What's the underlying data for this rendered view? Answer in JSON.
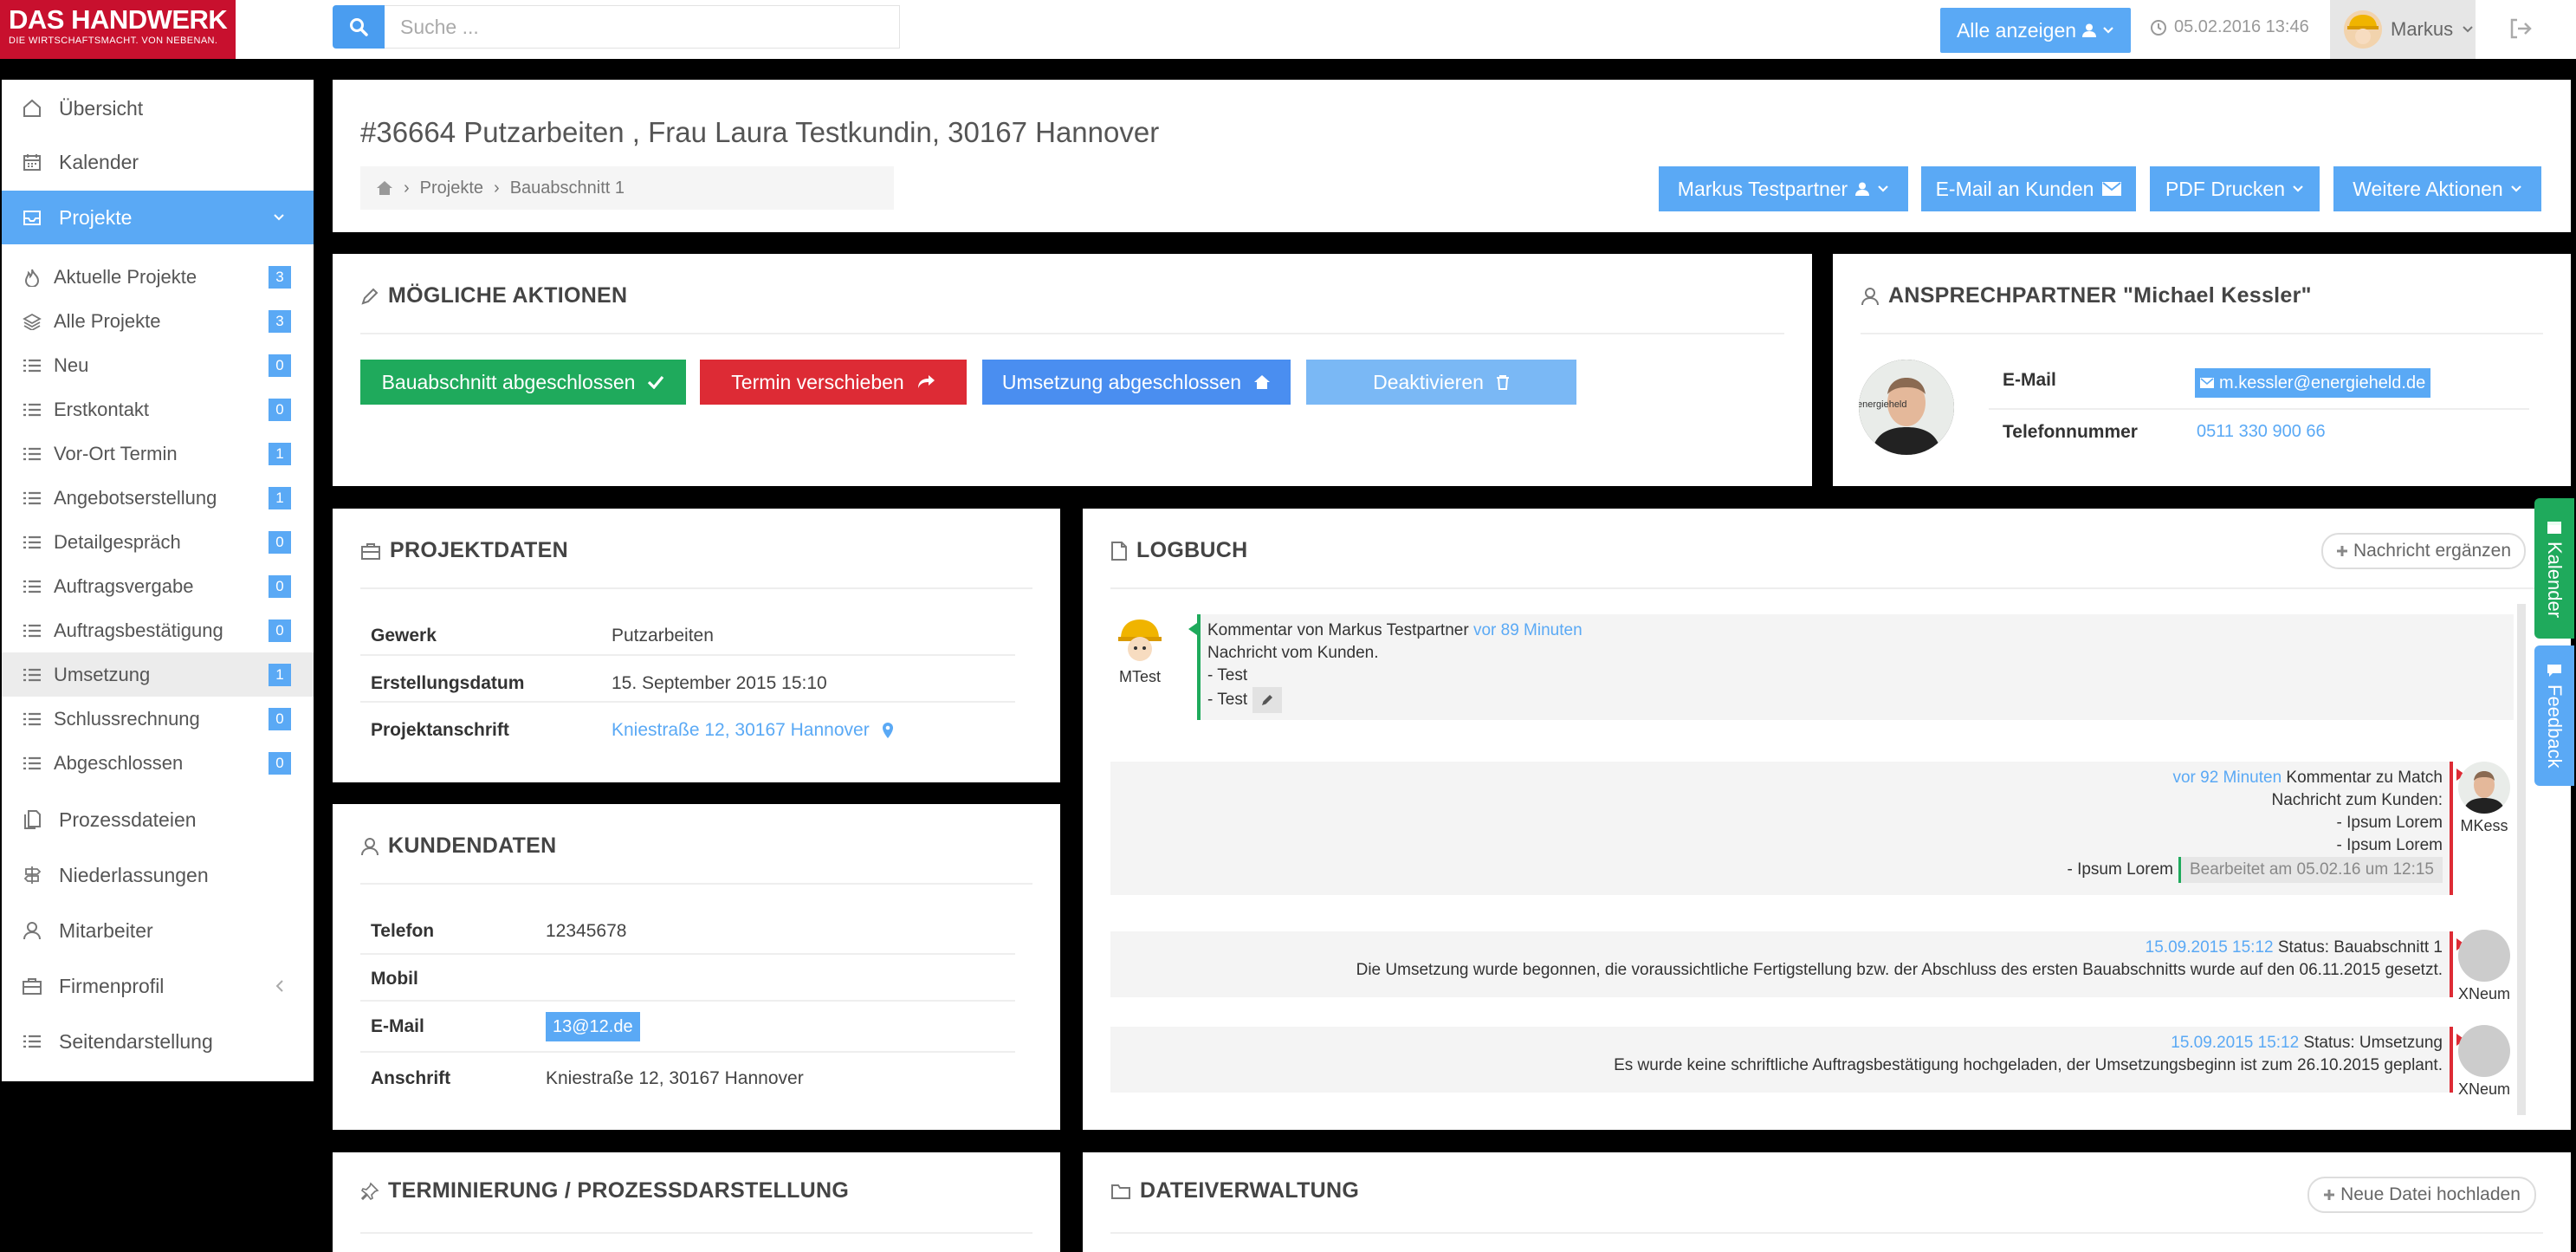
{
  "app": {
    "logo_main": "DAS HANDWERK",
    "logo_sub": "DIE WIRTSCHAFTSMACHT. VON NEBENAN."
  },
  "topbar": {
    "search_placeholder": "Suche ...",
    "show_all_label": "Alle anzeigen",
    "datetime": "05.02.2016 13:46",
    "user_name": "Markus"
  },
  "sidebar": {
    "main_items": [
      {
        "label": "Übersicht",
        "icon": "home-icon"
      },
      {
        "label": "Kalender",
        "icon": "calendar-icon"
      },
      {
        "label": "Projekte",
        "icon": "inbox-icon"
      }
    ],
    "sub_items": [
      {
        "label": "Aktuelle Projekte",
        "count": "3",
        "icon": "fire-icon"
      },
      {
        "label": "Alle Projekte",
        "count": "3",
        "icon": "layers-icon"
      },
      {
        "label": "Neu",
        "count": "0",
        "icon": "list-icon"
      },
      {
        "label": "Erstkontakt",
        "count": "0",
        "icon": "list-icon"
      },
      {
        "label": "Vor-Ort Termin",
        "count": "1",
        "icon": "list-icon"
      },
      {
        "label": "Angebotserstellung",
        "count": "1",
        "icon": "list-icon"
      },
      {
        "label": "Detailgespräch",
        "count": "0",
        "icon": "list-icon"
      },
      {
        "label": "Auftragsvergabe",
        "count": "0",
        "icon": "list-icon"
      },
      {
        "label": "Auftragsbestätigung",
        "count": "0",
        "icon": "list-icon"
      },
      {
        "label": "Umsetzung",
        "count": "1",
        "icon": "list-icon"
      },
      {
        "label": "Schlussrechnung",
        "count": "0",
        "icon": "list-icon"
      },
      {
        "label": "Abgeschlossen",
        "count": "0",
        "icon": "list-icon"
      }
    ],
    "bottom_items": [
      {
        "label": "Prozessdateien",
        "icon": "files-icon"
      },
      {
        "label": "Niederlassungen",
        "icon": "signpost-icon"
      },
      {
        "label": "Mitarbeiter",
        "icon": "user-icon"
      },
      {
        "label": "Firmenprofil",
        "icon": "briefcase-icon"
      },
      {
        "label": "Seitendarstellung",
        "icon": "list-icon"
      }
    ]
  },
  "header": {
    "title": "#36664 Putzarbeiten , Frau Laura Testkundin, 30167 Hannover",
    "breadcrumb": [
      "Projekte",
      "Bauabschnitt 1"
    ],
    "buttons": {
      "partner": "Markus Testpartner",
      "email_customer": "E-Mail an Kunden",
      "pdf_print": "PDF Drucken",
      "more_actions": "Weitere Aktionen"
    }
  },
  "actions": {
    "title": "MÖGLICHE AKTIONEN",
    "buttons": [
      {
        "label": "Bauabschnitt abgeschlossen",
        "color": "#1faa5c"
      },
      {
        "label": "Termin verschieben",
        "color": "#dd2b35"
      },
      {
        "label": "Umsetzung abgeschlossen",
        "color": "#4a8ef0"
      },
      {
        "label": "Deaktivieren",
        "color": "#7ab8f5"
      }
    ]
  },
  "contact": {
    "title": "ANSPRECHPARTNER \"Michael Kessler\"",
    "email_label": "E-Mail",
    "email_value": "m.kessler@energieheld.de",
    "phone_label": "Telefonnummer",
    "phone_value": "0511 330 900 66",
    "avatar_text": "energieheld"
  },
  "project": {
    "title": "PROJEKTDATEN",
    "rows": [
      {
        "label": "Gewerk",
        "value": "Putzarbeiten"
      },
      {
        "label": "Erstellungsdatum",
        "value": "15. September 2015 15:10"
      },
      {
        "label": "Projektanschrift",
        "value": "Kniestraße 12, 30167 Hannover"
      }
    ]
  },
  "customer": {
    "title": "KUNDENDATEN",
    "rows": [
      {
        "label": "Telefon",
        "value": "12345678"
      },
      {
        "label": "Mobil",
        "value": ""
      },
      {
        "label": "E-Mail",
        "value": "13@12.de"
      },
      {
        "label": "Anschrift",
        "value": "Kniestraße 12, 30167 Hannover"
      }
    ]
  },
  "logbook": {
    "title": "LOGBUCH",
    "add_button": "Nachricht ergänzen",
    "entries": [
      {
        "author": "MTest",
        "head_prefix": "Kommentar von Markus Testpartner",
        "time": "vor 89 Minuten",
        "lines": [
          "Nachricht vom Kunden.",
          "- Test",
          "- Test"
        ]
      },
      {
        "author": "MKess",
        "time": "vor 92 Minuten",
        "head_suffix": "Kommentar zu Match",
        "lines": [
          "Nachricht zum Kunden:",
          "- Ipsum Lorem",
          "- Ipsum Lorem",
          "- Ipsum Lorem"
        ],
        "edited": "Bearbeitet am 05.02.16 um 12:15"
      },
      {
        "author": "XNeum",
        "time": "15.09.2015 15:12",
        "head_suffix": "Status: Bauabschnitt 1",
        "lines": [
          "Die Umsetzung wurde begonnen, die voraussichtliche Fertigstellung bzw. der Abschluss des ersten Bauabschnitts wurde auf den 06.11.2015 gesetzt."
        ]
      },
      {
        "author": "XNeum",
        "time": "15.09.2015 15:12",
        "head_suffix": "Status: Umsetzung",
        "lines": [
          "Es wurde keine schriftliche Auftragsbestätigung hochgeladen, der Umsetzungsbeginn ist zum 26.10.2015 geplant."
        ]
      }
    ]
  },
  "scheduling": {
    "title": "TERMINIERUNG / PROZESSDARSTELLUNG"
  },
  "files": {
    "title": "DATEIVERWALTUNG",
    "upload_button": "Neue Datei hochladen"
  },
  "side_tabs": {
    "calendar": "Kalender",
    "feedback": "Feedback"
  },
  "colors": {
    "accent": "#5aa9f5",
    "brand": "#c8102e",
    "green": "#1faa5c",
    "red": "#dd2b35"
  }
}
